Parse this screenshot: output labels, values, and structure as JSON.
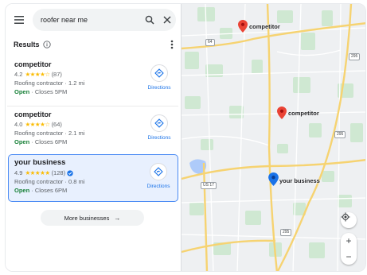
{
  "search": {
    "query": "roofer near me"
  },
  "results": {
    "title": "Results"
  },
  "listings": [
    {
      "name": "competitor",
      "rating": "4.2",
      "stars": "★★★★☆",
      "reviews": "(87)",
      "category": "Roofing contractor · 1.2 mi",
      "status": "Open",
      "hours": " · Closes 5PM",
      "directions_label": "Directions"
    },
    {
      "name": "competitor",
      "rating": "4.0",
      "stars": "★★★★☆",
      "reviews": "(64)",
      "category": "Roofing contractor · 2.1 mi",
      "status": "Open",
      "hours": " · Closes 6PM",
      "directions_label": "Directions"
    },
    {
      "name": "your business",
      "rating": "4.9",
      "stars": "★★★★★",
      "reviews": "(128)",
      "category": "Roofing contractor · 0.8 mi",
      "status": "Open",
      "hours": " · Closes 6PM",
      "directions_label": "Directions",
      "verified": true
    }
  ],
  "more_businesses": {
    "label": "More businesses"
  },
  "map": {
    "pins": [
      {
        "label": "competitor",
        "color": "#ea4335"
      },
      {
        "label": "competitor",
        "color": "#ea4335"
      },
      {
        "label": "your business",
        "color": "#1a73e8"
      }
    ],
    "road_shields": [
      "64",
      "295",
      "US 17",
      "295",
      "295"
    ],
    "zoom_in": "+",
    "zoom_out": "−"
  },
  "colors": {
    "accent": "#1a73e8",
    "open": "#188038",
    "star": "#fbbc04",
    "competitor_pin": "#ea4335",
    "selected_bg": "#e8f0fe"
  }
}
